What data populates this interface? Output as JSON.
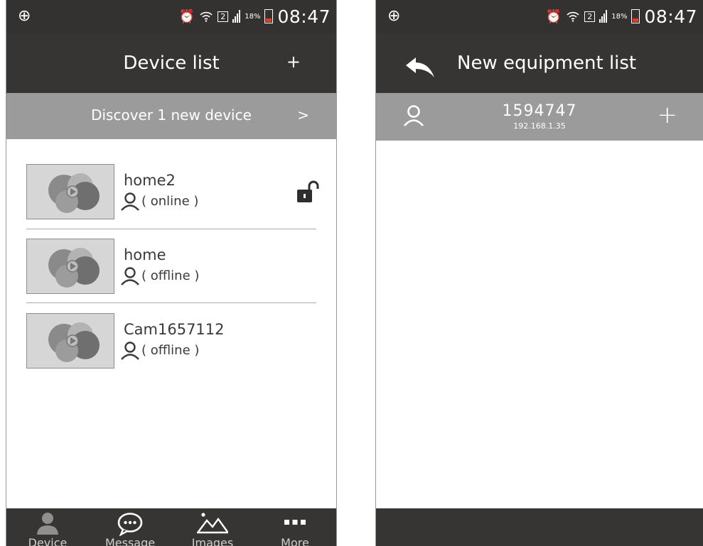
{
  "status_bar": {
    "sim_slot": "2",
    "battery_percent": "18%",
    "time": "08:47"
  },
  "left_screen": {
    "title": "Device list",
    "add_label": "+",
    "discover": {
      "text": "Discover 1 new device",
      "chevron": ">"
    },
    "devices": [
      {
        "name": "home2",
        "status": "( online )",
        "locked": false
      },
      {
        "name": "home",
        "status": "( offline )",
        "locked": null
      },
      {
        "name": "Cam1657112",
        "status": "( offline )",
        "locked": null
      }
    ],
    "nav": [
      {
        "label": "Device",
        "icon": "person-icon"
      },
      {
        "label": "Message",
        "icon": "chat-bubble-icon"
      },
      {
        "label": "Images",
        "icon": "mountain-image-icon"
      },
      {
        "label": "More",
        "icon": "more-dots-icon"
      }
    ]
  },
  "right_screen": {
    "title": "New equipment list",
    "equipment": {
      "id": "1594747",
      "ip": "192.168.1.35",
      "add_label": "+"
    }
  },
  "colors": {
    "header": "#363533",
    "status_bar": "#333230",
    "discover_bar": "#9b9b9b",
    "battery_accent": "#e23a25"
  }
}
